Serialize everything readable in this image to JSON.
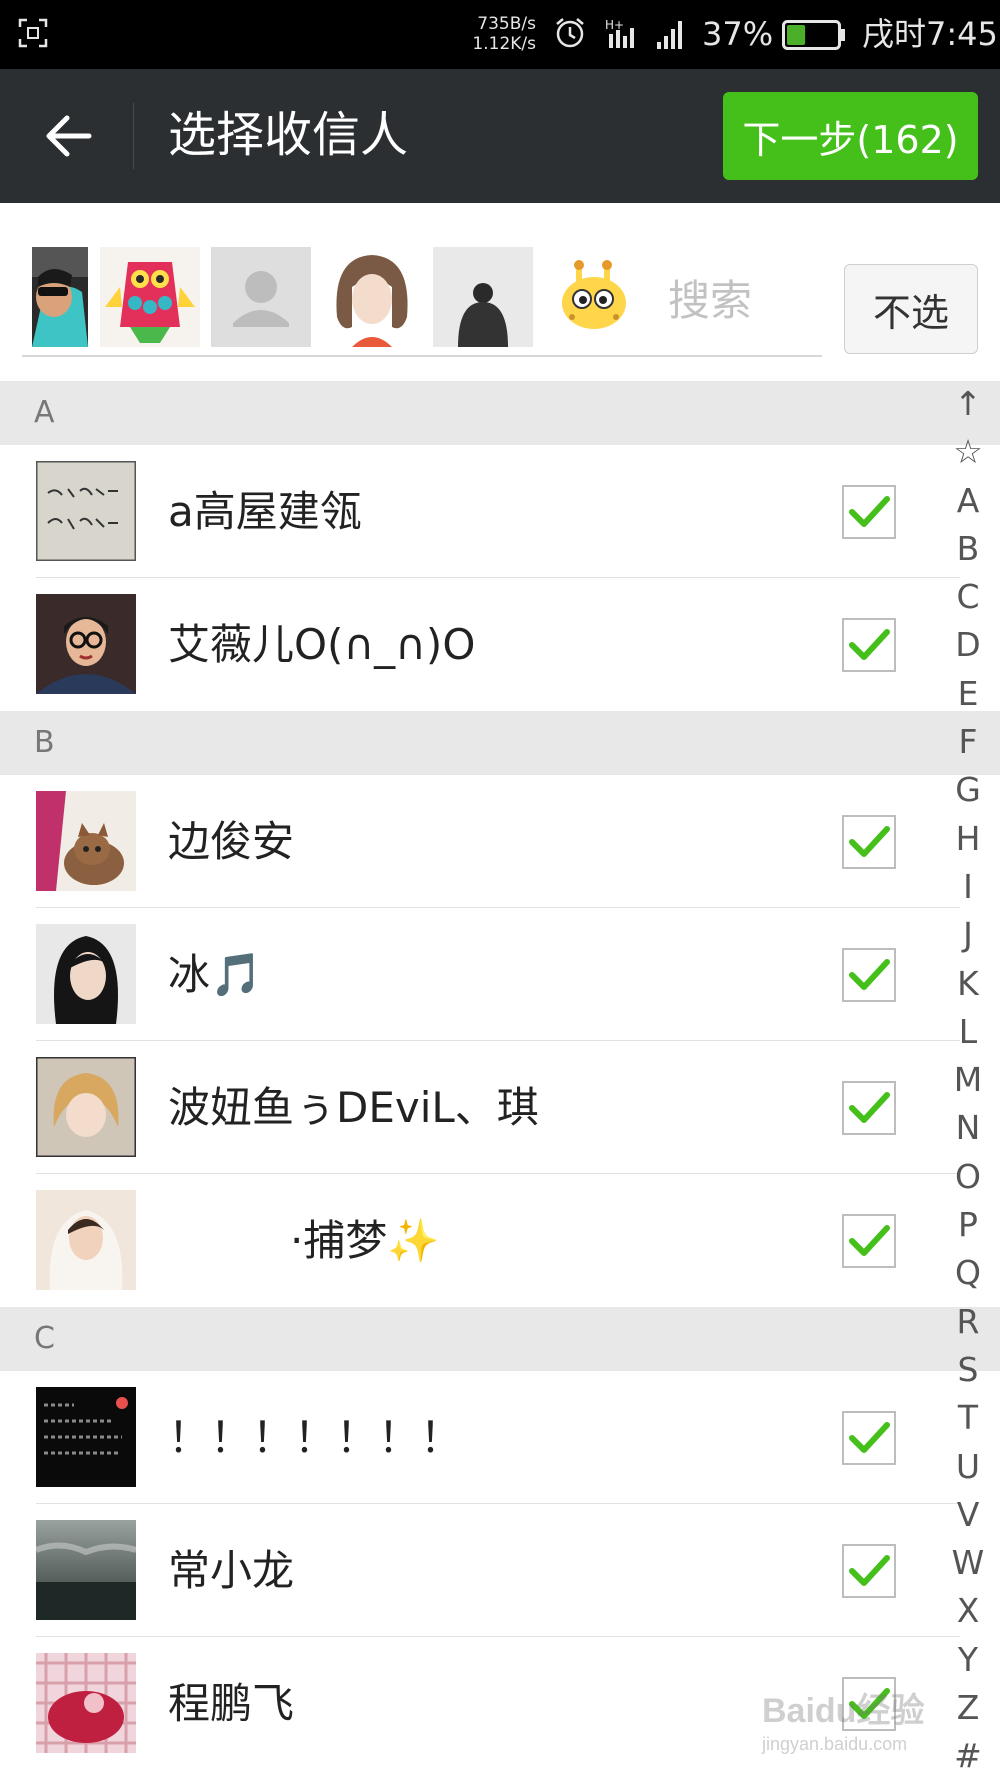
{
  "status_bar": {
    "net_up": "735B/s",
    "net_down": "1.12K/s",
    "battery_percent": "37%",
    "battery_level": 0.37,
    "time": "戌时7:45",
    "icons": [
      "screenshot-icon",
      "alarm-icon",
      "data-signal-icon",
      "cell-signal-icon",
      "battery-icon"
    ]
  },
  "header": {
    "title": "选择收信人",
    "next_label": "下一步(162)",
    "accent": "#45c01a"
  },
  "selected_strip": {
    "search_placeholder": "搜索",
    "unselect_label": "不选",
    "avatars": [
      "avatar-car-selfie",
      "avatar-owl-cartoon",
      "avatar-default",
      "avatar-girl-drawing",
      "avatar-bun-hair",
      "avatar-giraffe-cartoon"
    ]
  },
  "sections": [
    {
      "letter": "A",
      "contacts": [
        {
          "name": "a高屋建瓴",
          "checked": true
        },
        {
          "name": "艾薇儿O(∩_∩)O",
          "checked": true
        }
      ]
    },
    {
      "letter": "B",
      "contacts": [
        {
          "name": "边俊安",
          "checked": true
        },
        {
          "name": "冰🎵",
          "checked": true
        },
        {
          "name": "波妞鱼ぅDEviL、琪",
          "checked": true
        },
        {
          "name": "·捕梦✨",
          "checked": true
        }
      ]
    },
    {
      "letter": "C",
      "contacts": [
        {
          "name": "！！！！！！！",
          "checked": true
        },
        {
          "name": "常小龙",
          "checked": true
        },
        {
          "name": "程鹏飞",
          "checked": true
        }
      ]
    }
  ],
  "index_bar": [
    "↑",
    "☆",
    "A",
    "B",
    "C",
    "D",
    "E",
    "F",
    "G",
    "H",
    "I",
    "J",
    "K",
    "L",
    "M",
    "N",
    "O",
    "P",
    "Q",
    "R",
    "S",
    "T",
    "U",
    "V",
    "W",
    "X",
    "Y",
    "Z",
    "#"
  ],
  "watermark": {
    "main": "Baidu经验",
    "sub": "jingyan.baidu.com"
  }
}
